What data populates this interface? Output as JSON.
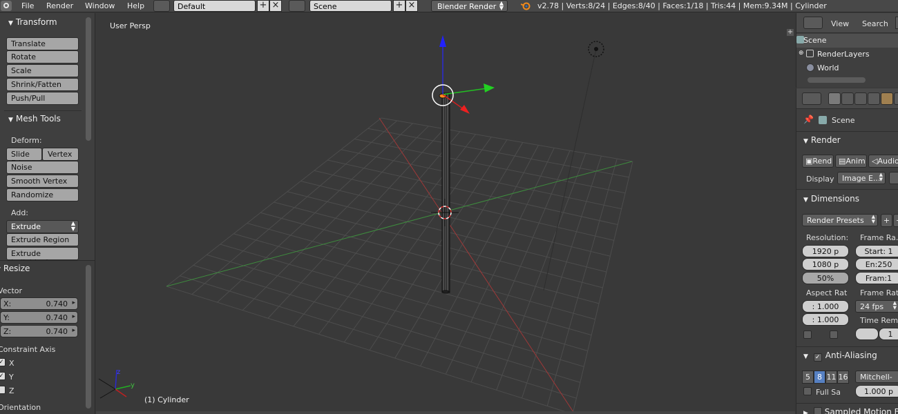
{
  "menu": {
    "file": "File",
    "render": "Render",
    "window": "Window",
    "help": "Help"
  },
  "header": {
    "screen_layout": "Default",
    "scene": "Scene",
    "engine": "Blender Render",
    "stats": "v2.78 | Verts:8/24 | Edges:8/40 | Faces:1/18 | Tris:44 | Mem:9.34M | Cylinder"
  },
  "toolshelf": {
    "transform_title": "Transform",
    "transform_buttons": [
      "Translate",
      "Rotate",
      "Scale",
      "Shrink/Fatten",
      "Push/Pull"
    ],
    "mesh_tools_title": "Mesh Tools",
    "deform_label": "Deform:",
    "slide_edge": "Slide Ed",
    "vertex": "Vertex",
    "noise": "Noise",
    "smooth_vertex": "Smooth Vertex",
    "randomize": "Randomize",
    "add_label": "Add:",
    "extrude": "Extrude",
    "extrude_region": "Extrude Region",
    "extrude_individual": "Extrude Individual",
    "resize_title": "Resize",
    "vector_label": "Vector",
    "vector": [
      {
        "label": "X:",
        "value": "0.740"
      },
      {
        "label": "Y:",
        "value": "0.740"
      },
      {
        "label": "Z:",
        "value": "0.740"
      }
    ],
    "constraint_label": "Constraint Axis",
    "constraint_axes": [
      "X",
      "Y",
      "Z"
    ],
    "orientation_label": "Orientation"
  },
  "viewport": {
    "view_name": "User Persp",
    "object_label": "(1) Cylinder"
  },
  "outliner": {
    "view": "View",
    "search": "Search",
    "items": [
      "Scene",
      "RenderLayers",
      "World"
    ]
  },
  "properties": {
    "context": "Scene",
    "render_title": "Render",
    "render_btn": "Rend",
    "anim_btn": "Anim",
    "audio_btn": "Audio",
    "display_label": "Display",
    "display_value": "Image E...",
    "dimensions_title": "Dimensions",
    "render_presets": "Render Presets",
    "resolution_label": "Resolution:",
    "res_x": "1920 p",
    "res_y": "1080 p",
    "res_pct": "50%",
    "frame_range_label": "Frame Ra...",
    "start": "Start: 1",
    "end": "En:250",
    "frame": "Fram:1",
    "aspect_label": "Aspect Rat",
    "aspect_x": ": 1.000",
    "aspect_y": ": 1.000",
    "frame_rate_label": "Frame Rate",
    "fps": "24 fps",
    "time_rem_label": "Time Rem.",
    "time_rem_value": "1",
    "aa_title": "Anti-Aliasing",
    "aa_samples": [
      "5",
      "8",
      "11",
      "16"
    ],
    "filter": "Mitchell-",
    "full_sample": "Full Sa",
    "filter_size": "1.000 p",
    "sampled_motion": "Sampled Motion B"
  }
}
